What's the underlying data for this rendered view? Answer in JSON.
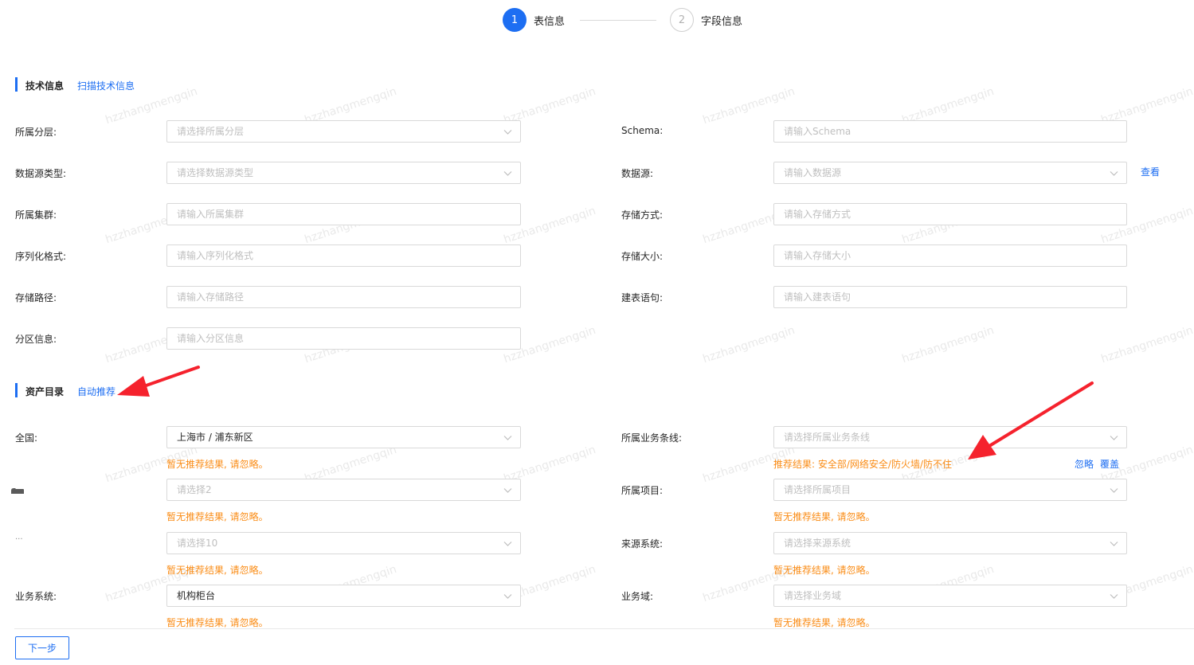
{
  "steps": [
    {
      "num": "1",
      "label": "表信息"
    },
    {
      "num": "2",
      "label": "字段信息"
    }
  ],
  "tech_section": {
    "title": "技术信息",
    "link": "扫描技术信息"
  },
  "tech_fields": {
    "layer": {
      "label": "所属分层:",
      "placeholder": "请选择所属分层"
    },
    "schema": {
      "label": "Schema:",
      "placeholder": "请输入Schema"
    },
    "ds_type": {
      "label": "数据源类型:",
      "placeholder": "请选择数据源类型"
    },
    "datasource": {
      "label": "数据源:",
      "placeholder": "请输入数据源",
      "link": "查看"
    },
    "cluster": {
      "label": "所属集群:",
      "placeholder": "请输入所属集群"
    },
    "storage_mode": {
      "label": "存储方式:",
      "placeholder": "请输入存储方式"
    },
    "serialization": {
      "label": "序列化格式:",
      "placeholder": "请输入序列化格式"
    },
    "storage_size": {
      "label": "存储大小:",
      "placeholder": "请输入存储大小"
    },
    "storage_path": {
      "label": "存储路径:",
      "placeholder": "请输入存储路径"
    },
    "ddl": {
      "label": "建表语句:",
      "placeholder": "请输入建表语句"
    },
    "partition": {
      "label": "分区信息:",
      "placeholder": "请输入分区信息"
    }
  },
  "asset_section": {
    "title": "资产目录",
    "link": "自动推荐"
  },
  "asset_fields": {
    "region": {
      "label": "全国:",
      "value": "上海市 / 浦东新区",
      "hint": "暂无推荐结果, 请忽略。"
    },
    "business_line": {
      "label": "所属业务条线:",
      "placeholder": "请选择所属业务条线",
      "hint": "推荐结果: 安全部/网络安全/防火墙/防不住",
      "ignore": "忽略",
      "override": "覆盖"
    },
    "select2": {
      "label": "",
      "placeholder": "请选择2",
      "hint": "暂无推荐结果, 请忽略。"
    },
    "project": {
      "label": "所属项目:",
      "placeholder": "请选择所属项目",
      "hint": "暂无推荐结果, 请忽略。"
    },
    "select10": {
      "label": "···",
      "placeholder": "请选择10",
      "hint": "暂无推荐结果, 请忽略。"
    },
    "source_system": {
      "label": "来源系统:",
      "placeholder": "请选择来源系统",
      "hint": "暂无推荐结果, 请忽略。"
    },
    "biz_system": {
      "label": "业务系统:",
      "value": "机构柜台",
      "hint": "暂无推荐结果, 请忽略。"
    },
    "biz_domain": {
      "label": "业务域:",
      "placeholder": "请选择业务域",
      "hint": "暂无推荐结果, 请忽略。"
    }
  },
  "footer": {
    "next": "下一步"
  },
  "watermark_text": "hzzhangmengqin",
  "colors": {
    "primary": "#1d6ef2",
    "warning": "#fa8c16",
    "annotation": "#f5222d"
  }
}
